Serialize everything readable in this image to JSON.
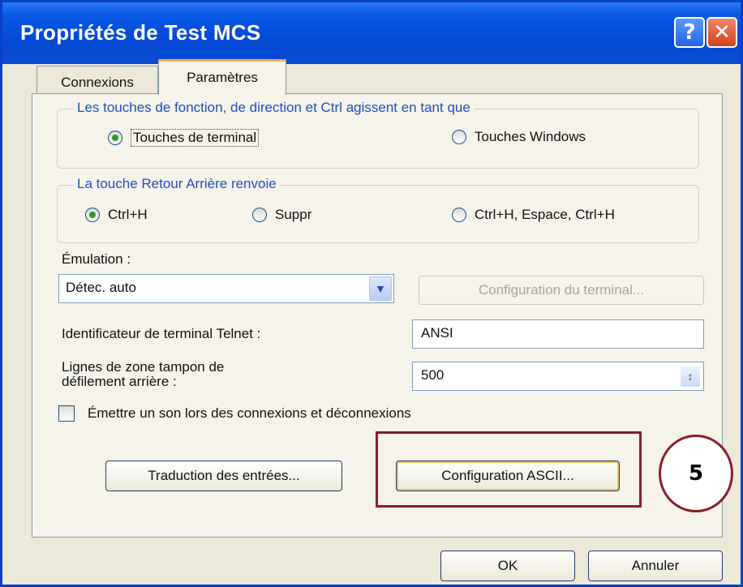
{
  "window": {
    "title": "Propriétés de Test MCS",
    "help_label": "?",
    "close_label": "✕"
  },
  "tabs": [
    {
      "label": "Connexions",
      "active": false
    },
    {
      "label": "Paramètres",
      "active": true
    }
  ],
  "function_keys_group": {
    "legend": "Les touches de fonction, de direction et Ctrl agissent en tant que",
    "options": [
      {
        "label": "Touches de terminal",
        "selected": true
      },
      {
        "label": "Touches Windows",
        "selected": false
      }
    ]
  },
  "backspace_group": {
    "legend": "La touche Retour Arrière renvoie",
    "options": [
      {
        "label": "Ctrl+H",
        "selected": true
      },
      {
        "label": "Suppr",
        "selected": false
      },
      {
        "label": "Ctrl+H, Espace, Ctrl+H",
        "selected": false
      }
    ]
  },
  "emulation": {
    "label": "Émulation :",
    "value": "Détec. auto",
    "terminal_config_button": "Configuration du terminal..."
  },
  "telnet": {
    "label": "Identificateur de terminal Telnet :",
    "value": "ANSI"
  },
  "scrollback": {
    "label_line1": "Lignes de zone tampon de",
    "label_line2": "défilement arrière :",
    "value": "500"
  },
  "sound_checkbox": {
    "label": "Émettre un son lors des connexions et déconnexions",
    "checked": false
  },
  "buttons": {
    "input_translation": "Traduction des entrées...",
    "ascii_config": "Configuration ASCII...",
    "ok": "OK",
    "cancel": "Annuler"
  },
  "annotation": {
    "step_number": "5",
    "color": "#8a1d2a"
  }
}
